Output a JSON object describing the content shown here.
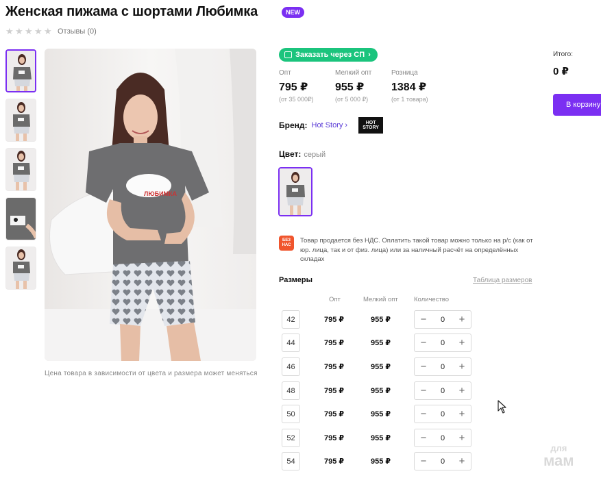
{
  "product": {
    "title": "Женская пижама с шортами Любимка",
    "badge": "NEW",
    "reviews": "Отзывы (0)",
    "rating_stars_filled": 0,
    "rating_stars_total": 5,
    "photo_caption": "Цена товара в зависимости от цвета и размера может меняться"
  },
  "order_sp": {
    "label": "Заказать через СП"
  },
  "prices": [
    {
      "label": "Опт",
      "value": "795 ₽",
      "note": "(от 35 000₽)"
    },
    {
      "label": "Мелкий опт",
      "value": "955 ₽",
      "note": "(от 5 000 ₽)"
    },
    {
      "label": "Розница",
      "value": "1384 ₽",
      "note": "(от 1 товара)"
    }
  ],
  "brand": {
    "label": "Бренд:",
    "name": "Hot Story",
    "logo_text": "HOT STORY"
  },
  "color": {
    "label": "Цвет:",
    "value": "серый"
  },
  "vat": {
    "icon_text": "БЕЗ НАС",
    "text": "Товар продается без НДС. Оплатить такой товар можно только на р/с (как от юр. лица, так и от физ. лица) или за наличный расчёт на определённых складах"
  },
  "sizes": {
    "title": "Размеры",
    "table_link": "Таблица размеров",
    "headers": {
      "opt": "Опт",
      "small_opt": "Мелкий опт",
      "qty": "Количество"
    },
    "rows": [
      {
        "size": "42",
        "opt": "795 ₽",
        "small_opt": "955 ₽",
        "qty": "0"
      },
      {
        "size": "44",
        "opt": "795 ₽",
        "small_opt": "955 ₽",
        "qty": "0"
      },
      {
        "size": "46",
        "opt": "795 ₽",
        "small_opt": "955 ₽",
        "qty": "0"
      },
      {
        "size": "48",
        "opt": "795 ₽",
        "small_opt": "955 ₽",
        "qty": "0"
      },
      {
        "size": "50",
        "opt": "795 ₽",
        "small_opt": "955 ₽",
        "qty": "0"
      },
      {
        "size": "52",
        "opt": "795 ₽",
        "small_opt": "955 ₽",
        "qty": "0"
      },
      {
        "size": "54",
        "opt": "795 ₽",
        "small_opt": "955 ₽",
        "qty": "0"
      }
    ]
  },
  "summary": {
    "total_label": "Итого:",
    "total_value": "0 ₽",
    "cart_button": "В корзину"
  },
  "watermark": {
    "line1": "для",
    "line2": "мам"
  },
  "colors": {
    "accent": "#7b2ff2",
    "green": "#1bc47d",
    "vat_orange": "#f0552d"
  }
}
